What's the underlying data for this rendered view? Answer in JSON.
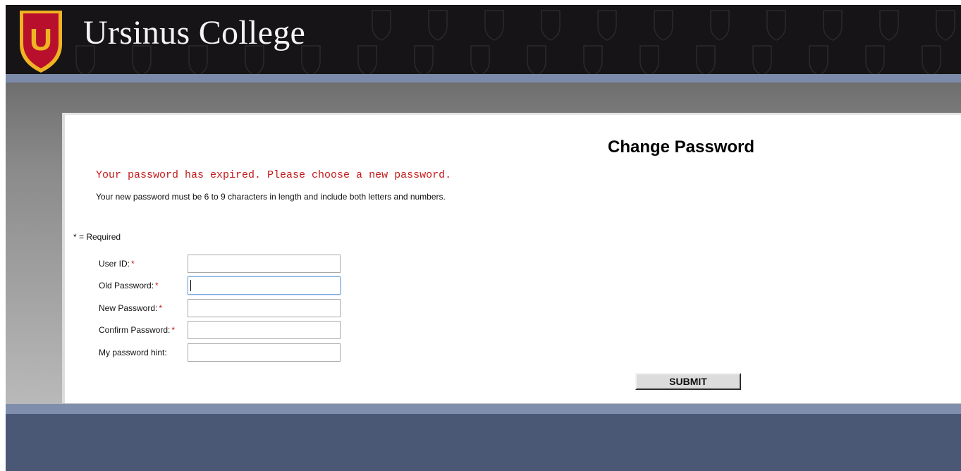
{
  "header": {
    "logo_letter": "U",
    "college_name": "Ursinus College",
    "colors": {
      "background": "#161416",
      "shield_red": "#b8102c",
      "shield_gold": "#f0b323"
    }
  },
  "form": {
    "title": "Change Password",
    "expired_message": "Your password has expired. Please choose a new password.",
    "rules_message": "Your new password must be 6 to 9 characters in length and include both letters and numbers.",
    "required_note": "* = Required",
    "required_marker": "*",
    "fields": [
      {
        "label": "User ID:",
        "required": true,
        "value": ""
      },
      {
        "label": "Old Password:",
        "required": true,
        "value": "",
        "focused": true
      },
      {
        "label": "New Password:",
        "required": true,
        "value": ""
      },
      {
        "label": "Confirm Password:",
        "required": true,
        "value": ""
      },
      {
        "label": "My password hint:",
        "required": false,
        "value": ""
      }
    ],
    "submit_label": "SUBMIT"
  },
  "colors": {
    "error_text": "#c41a1a",
    "band": "#7b8ba9",
    "footer": "#4a5775"
  }
}
